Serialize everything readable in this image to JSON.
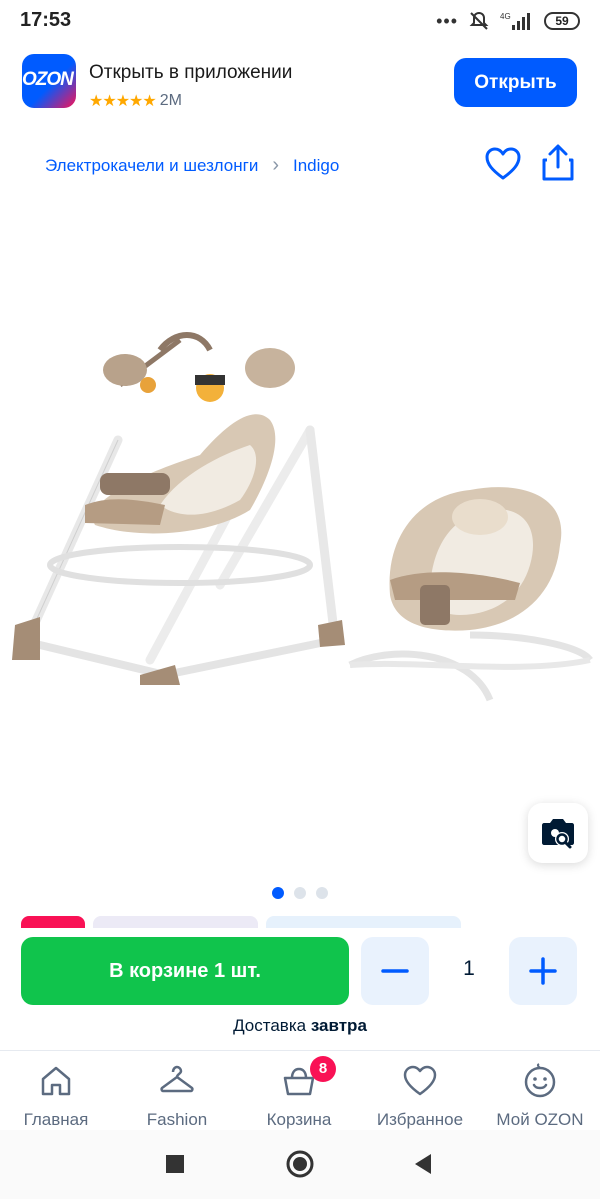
{
  "status_bar": {
    "time": "17:53",
    "dots": "•••",
    "battery": "59",
    "network": "4G"
  },
  "app_banner": {
    "logo_text": "OZON",
    "title": "Открыть в приложении",
    "stars": "★★★★★",
    "rating_count": "2M",
    "open_label": "Открыть"
  },
  "breadcrumb": {
    "category": "Электрокачели и шезлонги",
    "separator": "›",
    "brand": "Indigo"
  },
  "gallery": {
    "total_slides": 3,
    "active_slide": 1
  },
  "cart": {
    "in_cart_label": "В корзине 1 шт.",
    "quantity": "1",
    "delivery_prefix": "Доставка ",
    "delivery_day": "завтра"
  },
  "tabs": [
    {
      "label": "Главная",
      "icon": "home-icon"
    },
    {
      "label": "Fashion",
      "icon": "hanger-icon"
    },
    {
      "label": "Корзина",
      "icon": "basket-icon"
    },
    {
      "label": "Избранное",
      "icon": "heart-icon"
    },
    {
      "label": "Мой OZON",
      "icon": "smiley-icon"
    }
  ],
  "cart_badge": "8",
  "colors": {
    "brand_blue": "#005bff",
    "cart_green": "#10c44c",
    "badge_pink": "#f91155",
    "star_orange": "#ffa800"
  }
}
